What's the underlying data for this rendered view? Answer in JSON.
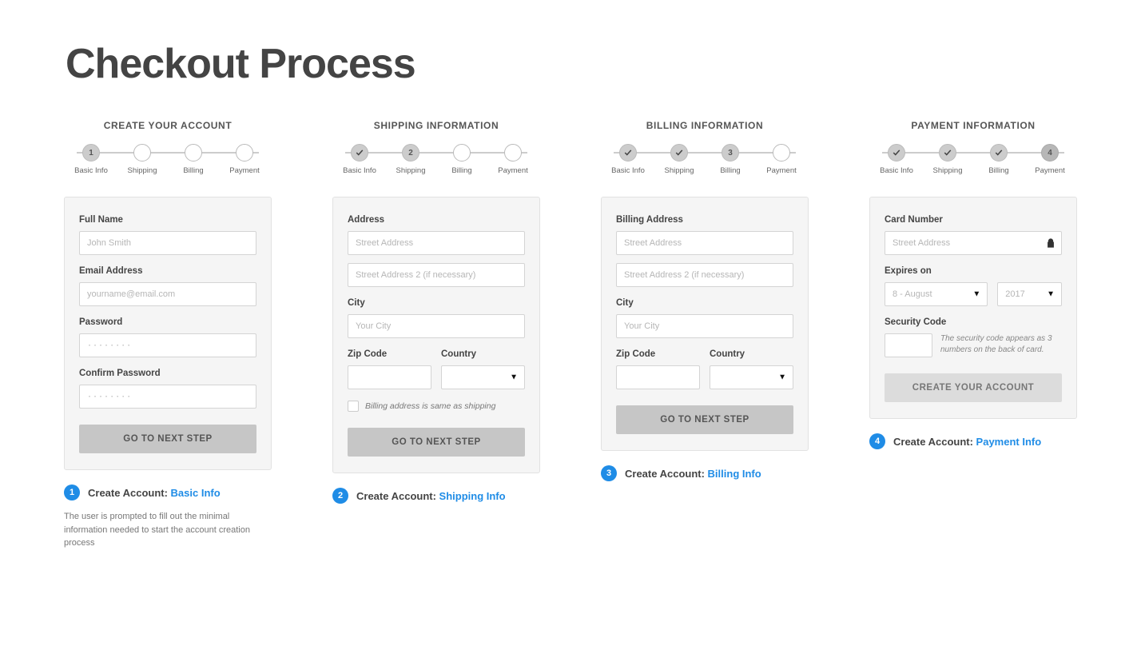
{
  "page_title": "Checkout Process",
  "stepper_labels": [
    "Basic Info",
    "Shipping",
    "Billing",
    "Payment"
  ],
  "panels": {
    "p1": {
      "title": "CREATE YOUR ACCOUNT",
      "fields": {
        "full_name": {
          "label": "Full Name",
          "placeholder": "John Smith"
        },
        "email": {
          "label": "Email Address",
          "placeholder": "yourname@email.com"
        },
        "password": {
          "label": "Password",
          "placeholder": "········"
        },
        "confirm": {
          "label": "Confirm Password",
          "placeholder": "········"
        }
      },
      "button": "GO TO NEXT STEP",
      "caption_num": "1",
      "caption_prefix": "Create Account: ",
      "caption_link": "Basic Info",
      "description": "The user is prompted to fill out the minimal information needed to start the account creation process"
    },
    "p2": {
      "title": "SHIPPING INFORMATION",
      "fields": {
        "address": {
          "label": "Address",
          "placeholder1": "Street Address",
          "placeholder2": "Street Address 2 (if necessary)"
        },
        "city": {
          "label": "City",
          "placeholder": "Your City"
        },
        "zip": {
          "label": "Zip Code"
        },
        "country": {
          "label": "Country"
        }
      },
      "checkbox_label": "Billing address is same as shipping",
      "button": "GO TO NEXT STEP",
      "caption_num": "2",
      "caption_prefix": "Create Account: ",
      "caption_link": "Shipping Info"
    },
    "p3": {
      "title": "BILLING INFORMATION",
      "fields": {
        "address": {
          "label": "Billing Address",
          "placeholder1": "Street Address",
          "placeholder2": "Street Address 2 (if necessary)"
        },
        "city": {
          "label": "City",
          "placeholder": "Your City"
        },
        "zip": {
          "label": "Zip Code"
        },
        "country": {
          "label": "Country"
        }
      },
      "button": "GO TO NEXT STEP",
      "caption_num": "3",
      "caption_prefix": "Create Account: ",
      "caption_link": "Billing Info"
    },
    "p4": {
      "title": "PAYMENT INFORMATION",
      "fields": {
        "card": {
          "label": "Card Number",
          "placeholder": "Street Address"
        },
        "expires": {
          "label": "Expires on",
          "month": "8 - August",
          "year": "2017"
        },
        "security": {
          "label": "Security Code",
          "hint": "The security code appears as 3 numbers on the back of card."
        }
      },
      "button": "CREATE YOUR ACCOUNT",
      "caption_num": "4",
      "caption_prefix": "Create Account: ",
      "caption_link": "Payment Info"
    }
  }
}
